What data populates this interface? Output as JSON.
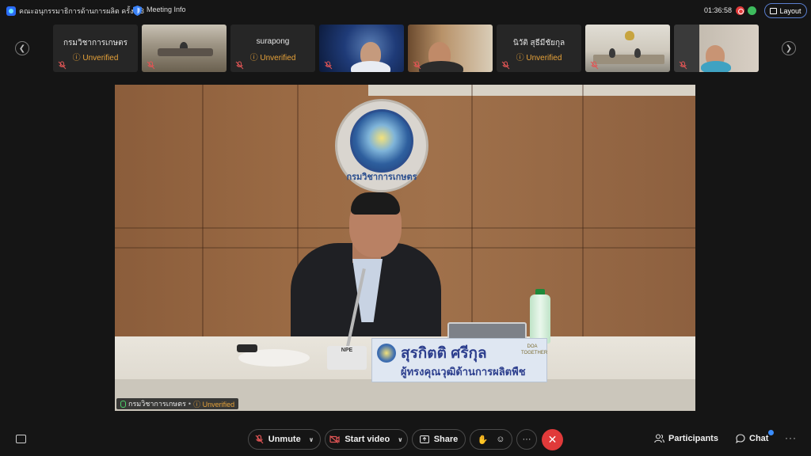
{
  "titlebar": {
    "meeting_title": "คณะอนุกรรมาธิการด้านการผลิต ครั้งที่ 3",
    "meeting_info": "Meeting Info",
    "elapsed_time": "01:36:58",
    "layout_label": "Layout"
  },
  "thumbnails": [
    {
      "name": "กรมวิชาการเกษตร",
      "status": "Unverified",
      "video": false
    },
    {
      "name": "",
      "status": "",
      "video": true
    },
    {
      "name": "surapong",
      "status": "Unverified",
      "video": false
    },
    {
      "name": "",
      "status": "",
      "video": true
    },
    {
      "name": "",
      "status": "",
      "video": true
    },
    {
      "name": "นิวัติ สุธีมีชัยกุล",
      "status": "Unverified",
      "video": false
    },
    {
      "name": "",
      "status": "",
      "video": true
    },
    {
      "name": "",
      "status": "",
      "video": true
    }
  ],
  "main_video": {
    "seal_text": "กรมวิชาการเกษตร",
    "mic_label": "NPE",
    "nameplate_name": "สุรกิตติ ศรีกุล",
    "nameplate_title": "ผู้ทรงคุณวุฒิด้านการผลิตพืช",
    "nameplate_badge": "DOA TOGETHER",
    "speaker_name": "กรมวิชาการเกษตร",
    "speaker_separator": "•",
    "speaker_status": "Unverified"
  },
  "toolbar": {
    "unmute": "Unmute",
    "start_video": "Start video",
    "share": "Share",
    "more": "···",
    "leave": "✕",
    "participants": "Participants",
    "chat": "Chat",
    "overflow": "···"
  },
  "colors": {
    "background": "#151515",
    "unverified": "#e8a33a",
    "leave": "#e03a3a",
    "accent": "#3a8dff"
  }
}
